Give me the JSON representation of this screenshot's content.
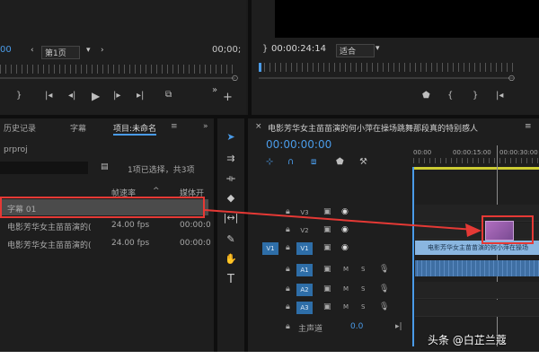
{
  "source_monitor": {
    "timecode_left": "00",
    "page_label": "第1页",
    "timecode_right": "00;00;"
  },
  "program_monitor": {
    "timecode": "00:00:24:14",
    "fit_label": "适合"
  },
  "project_panel": {
    "tabs": [
      "历史记录",
      "字幕",
      "项目:未命名"
    ],
    "menu_glyph": "≡",
    "overflow_glyph": "»",
    "filename": "prproj",
    "selection_info": "1项已选择，共3项",
    "col_headers": [
      "帧速率",
      "媒体开"
    ],
    "items": [
      {
        "name": "字幕 01",
        "fps": "",
        "start": "",
        "selected": true
      },
      {
        "name": "电影芳华女主苗苗演的(",
        "fps": "24.00 fps",
        "start": "00:00:0"
      },
      {
        "name": "电影芳华女主苗苗演的(",
        "fps": "24.00 fps",
        "start": "00:00:0"
      }
    ]
  },
  "timeline": {
    "title": "电影芳华女主苗苗演的何小萍在操场跳舞那段真的特别感人",
    "menu_glyph": "≡",
    "timecode": "00:00:00:00",
    "ruler_labels": [
      "00:00",
      "00:00:15:00",
      "00:00:30:00"
    ],
    "video_tracks": [
      {
        "id": "V3",
        "source": ""
      },
      {
        "id": "V2",
        "source": ""
      },
      {
        "id": "V1",
        "source": "V1"
      }
    ],
    "audio_tracks": [
      {
        "id": "A1",
        "source": "A1",
        "m": "M",
        "s": "S"
      },
      {
        "id": "A2",
        "source": "",
        "m": "M",
        "s": "S"
      },
      {
        "id": "A3",
        "source": "",
        "m": "M",
        "s": "S"
      }
    ],
    "master": {
      "label": "主声道",
      "value": "0.0"
    },
    "v1_clip_label": "电影芳华女主苗苗演的何小萍在操场"
  },
  "watermark": "头条 @白芷兰蔻",
  "colors": {
    "accent": "#4a9be8",
    "annotation_red": "#e53935",
    "clip_video": "#8ab6e0",
    "clip_audio": "#3f6fa3",
    "track_active": "#2e6ea8",
    "playhead": "#cccc33"
  },
  "icons": [
    "selection-tool-icon",
    "track-select-icon",
    "ripple-edit-icon",
    "razor-icon",
    "slip-icon",
    "pen-icon",
    "hand-icon",
    "type-icon",
    "lock-icon",
    "eye-icon",
    "film-icon",
    "mic-icon",
    "play-icon",
    "step-back-icon",
    "step-forward-icon",
    "export-frame-icon",
    "add-icon",
    "wrench-icon",
    "marker-icon",
    "link-icon",
    "snap-icon"
  ]
}
